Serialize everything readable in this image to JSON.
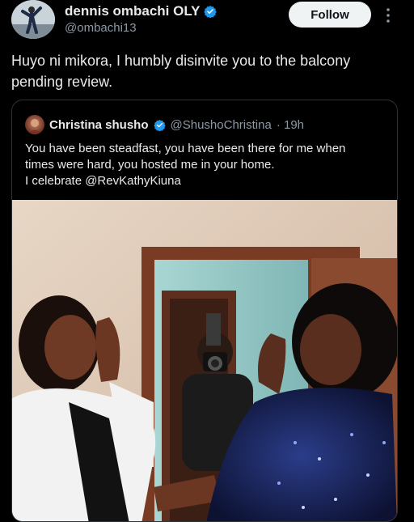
{
  "author": {
    "display_name": "dennis ombachi OLY",
    "handle": "@ombachi13",
    "avatar_icon": "profile-photo"
  },
  "follow_label": "Follow",
  "tweet_text": "Huyo ni mikora, I humbly disinvite you to the balcony pending review.",
  "quoted": {
    "display_name": "Christina shusho",
    "handle": "@ShushoChristina",
    "time": "· 19h",
    "text_lines": [
      "You have been steadfast, you have been there for me when",
      "times were hard, you hosted me in your home.",
      "I celebrate @RevKathyKiuna"
    ]
  },
  "colors": {
    "background": "#000000",
    "text": "#e7e9ea",
    "muted": "#8b98a5",
    "verified_blue": "#1d9bf0",
    "follow_bg": "#eff3f4"
  }
}
